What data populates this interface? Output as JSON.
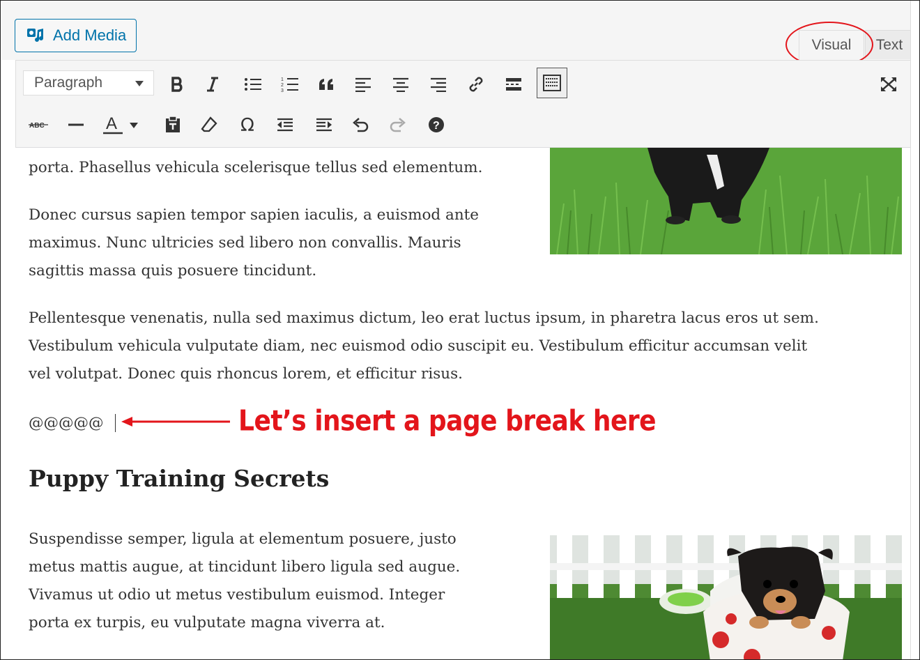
{
  "toolbar": {
    "add_media_label": "Add Media",
    "tab_visual": "Visual",
    "tab_text": "Text",
    "format_value": "Paragraph"
  },
  "icons": {
    "row1": [
      "bold-icon",
      "italic-icon",
      "bullet-list-icon",
      "numbered-list-icon",
      "blockquote-icon",
      "align-left-icon",
      "align-center-icon",
      "align-right-icon",
      "link-icon",
      "read-more-icon",
      "toolbar-toggle-icon",
      "fullscreen-icon"
    ],
    "row2": [
      "strikethrough-icon",
      "horizontal-line-icon",
      "text-color-icon",
      "paste-text-icon",
      "clear-formatting-icon",
      "special-character-icon",
      "outdent-icon",
      "indent-icon",
      "undo-icon",
      "redo-icon",
      "help-icon"
    ]
  },
  "content": {
    "para1_tail": "porta. Phasellus vehicula scelerisque tellus sed elementum.",
    "para2_lines": [
      "Donec cursus sapien tempor sapien iaculis, a euismod ante",
      "maximus. Nunc ultricies sed libero non convallis. Mauris",
      "sagittis massa quis posuere tincidunt."
    ],
    "para3_lines": [
      "Pellentesque venenatis, nulla sed maximus dictum, leo erat luctus ipsum, in pharetra lacus eros ut sem.",
      "Vestibulum vehicula vulputate diam, nec euismod odio suscipit eu. Vestibulum efficitur accumsan velit",
      "vel volutpat. Donec quis rhoncus lorem, et efficitur risus."
    ],
    "marker": "@@@@@",
    "heading": "Puppy Training Secrets",
    "para4_lines": [
      "Suspendisse semper, ligula at elementum posuere, justo",
      "metus mattis augue, at tincidunt libero ligula sed augue.",
      "Vivamus ut odio ut metus vestibulum euismod. Integer",
      "porta ex turpis, eu vulputate magna viverra at."
    ]
  },
  "annotation": {
    "text": "Let’s insert a page break here",
    "color": "#e3151b"
  },
  "colors": {
    "accent": "#0073aa",
    "annotation": "#e3151b"
  }
}
